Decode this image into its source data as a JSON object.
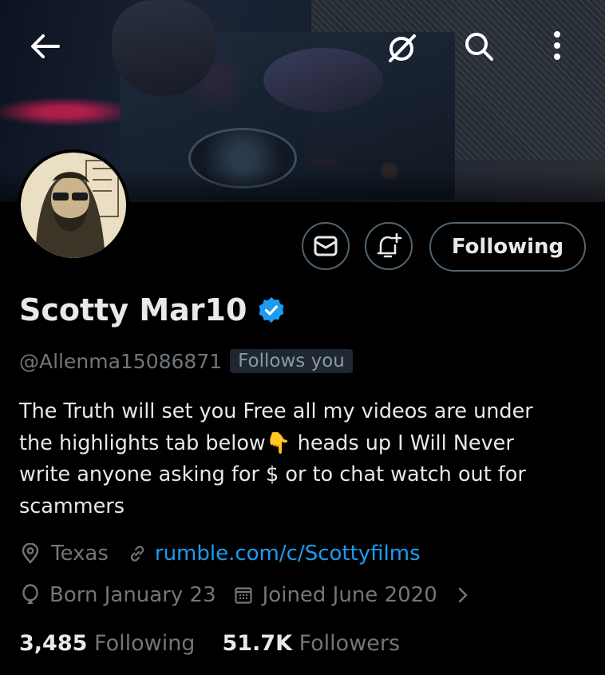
{
  "header": {
    "back_icon": "arrow-left-icon",
    "grok_icon": "grok-icon",
    "search_icon": "search-icon",
    "more_icon": "more-vertical-icon"
  },
  "profile": {
    "name": "Scotty Mar10",
    "verified_icon": "verified-badge-icon",
    "handle": "@Allenma15086871",
    "follows_you": "Follows you",
    "bio_parts": {
      "line1": "The Truth will set you Free all my videos are under",
      "line2a": "the highlights tab below",
      "emoji": "👇",
      "line2b": " heads up I Will Never",
      "line3": "write anyone asking for $ or to chat watch out for",
      "line4": "scammers"
    },
    "location": "Texas",
    "website": "rumble.com/c/Scottyfilms",
    "birthday": "Born January 23",
    "joined": "Joined June 2020",
    "following_count": "3,485",
    "following_label": "Following",
    "followers_count": "51.7K",
    "followers_label": "Followers"
  },
  "actions": {
    "message_icon": "mail-icon",
    "notify_icon": "bell-plus-icon",
    "follow_label": "Following"
  },
  "colors": {
    "background": "#000000",
    "text": "#e7e9ea",
    "secondary": "#71767b",
    "link": "#1d9bf0",
    "border": "#536471"
  }
}
